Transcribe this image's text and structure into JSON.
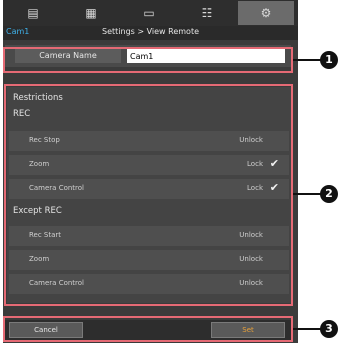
{
  "tabs": [
    {
      "icon": "clip-edit-icon",
      "glyph": "▤"
    },
    {
      "icon": "metadata-icon",
      "glyph": "▦"
    },
    {
      "icon": "monitor-icon",
      "glyph": "▭"
    },
    {
      "icon": "network-icon",
      "glyph": "☷"
    },
    {
      "icon": "settings-gear-icon",
      "glyph": "⚙",
      "active": true
    }
  ],
  "header": {
    "camera_id": "Cam1",
    "title": "Settings > View Remote"
  },
  "camera_name": {
    "label": "Camera Name",
    "value": "Cam1"
  },
  "restrictions": {
    "title": "Restrictions",
    "rec_title": "REC",
    "rec_items": [
      {
        "label": "Rec Stop",
        "value": "Unlock",
        "checked": false
      },
      {
        "label": "Zoom",
        "value": "Lock",
        "checked": true
      },
      {
        "label": "Camera Control",
        "value": "Lock",
        "checked": true
      }
    ],
    "except_title": "Except REC",
    "except_items": [
      {
        "label": "Rec Start",
        "value": "Unlock"
      },
      {
        "label": "Zoom",
        "value": "Unlock"
      },
      {
        "label": "Camera Control",
        "value": "Unlock"
      }
    ]
  },
  "buttons": {
    "cancel": "Cancel",
    "set": "Set"
  },
  "callouts": [
    "1",
    "2",
    "3"
  ],
  "checkmark": "✔"
}
